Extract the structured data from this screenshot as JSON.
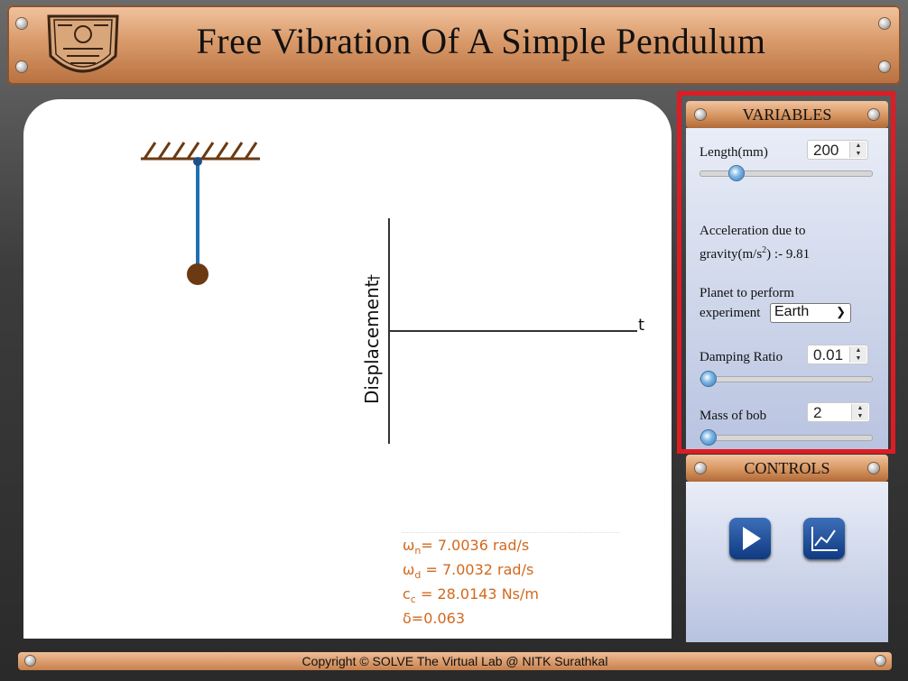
{
  "header": {
    "title": "Free Vibration Of A Simple Pendulum"
  },
  "graph": {
    "y_axis_label": "Displacement",
    "y_arrow": "†",
    "x_axis_label": "t"
  },
  "results": {
    "wn_sym": "ω",
    "wn_sub": "n",
    "wn_text": "= 7.0036 rad/s",
    "wd_sym": "ω",
    "wd_sub": "d",
    "wd_text": " = 7.0032 rad/s",
    "cc_sym": "c",
    "cc_sub": "c",
    "cc_text": " = 28.0143 Ns/m",
    "delta": "δ=0.063"
  },
  "variables": {
    "title": "VARIABLES",
    "length_label": "Length(mm)",
    "length_value": "200",
    "length_fraction": 0.18,
    "gravity_label_1": "Acceleration due to",
    "gravity_label_2": "gravity(m/s",
    "gravity_exp": "2",
    "gravity_label_3": ") :- 9.81",
    "planet_label_1": "Planet to perform",
    "planet_label_2": "experiment",
    "planet_value": "Earth",
    "damping_label": "Damping Ratio",
    "damping_value": "0.01",
    "damping_fraction": 0.0,
    "mass_label": "Mass of bob",
    "mass_value": "2",
    "mass_fraction": 0.0
  },
  "controls": {
    "title": "CONTROLS"
  },
  "footer": {
    "copyright": "Copyright © SOLVE The Virtual Lab @ NITK Surathkal"
  },
  "colors": {
    "accent_orange": "#d2691e",
    "highlight_red": "#e01b24",
    "pendulum_rod": "#1f6fb2",
    "pendulum_bob": "#6b3a12"
  },
  "icons": {
    "play": "play-icon",
    "graph": "graph-icon"
  }
}
